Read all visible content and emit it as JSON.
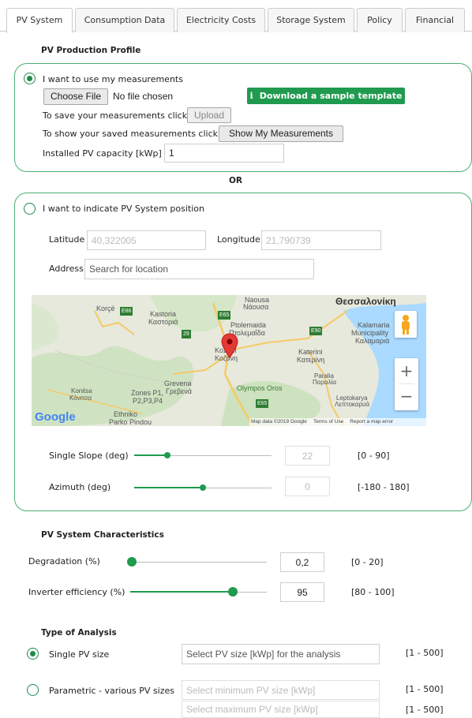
{
  "tabs": [
    {
      "label": "PV System",
      "active": true
    },
    {
      "label": "Consumption Data"
    },
    {
      "label": "Electricity Costs"
    },
    {
      "label": "Storage System"
    },
    {
      "label": "Policy"
    },
    {
      "label": "Financial"
    }
  ],
  "profile": {
    "title": "PV Production Profile",
    "option1": {
      "label": "I want to use my measurements",
      "choose_file": "Choose File",
      "no_file": "No file chosen",
      "download_icon_char": "i",
      "download_label": "Download a sample template",
      "save_text": "To save your measurements click",
      "upload_label": "Upload",
      "show_text": "To show your saved measurements click",
      "show_label": "Show My Measurements",
      "capacity_label": "Installed PV capacity [kWp]",
      "capacity_value": "1"
    },
    "or": "OR",
    "option2": {
      "label": "I want to indicate PV System position",
      "latitude_label": "Latitude",
      "latitude_value": "40,322005",
      "longitude_label": "Longitude",
      "longitude_value": "21,790739",
      "address_label": "Address",
      "address_placeholder": "Search for location",
      "map": {
        "places": [
          "Korçë",
          "Kastoria",
          "Καστοριά",
          "Naousa",
          "Νάουσα",
          "Θεσσαλονίκη",
          "Ptolemaida",
          "Πτολεμαΐδα",
          "Kalamaria",
          "Municipality",
          "Καλαμαριά",
          "Kozani",
          "Κοζάνη",
          "Katerini",
          "Κατερίνη",
          "Paralia",
          "Παραλία",
          "Grevena",
          "Γρεβενά",
          "Olympos Oros",
          "Zones P1,",
          "P2,P3,P4",
          "Konitsa",
          "Κόνιτσα",
          "Leptokarya",
          "Λεπτοκαρυά",
          "Ethniko",
          "Parko Pindou"
        ],
        "roads": [
          "E86",
          "E65",
          "29",
          "E90",
          "E65"
        ],
        "zoom_in": "+",
        "zoom_out": "−",
        "logo": "Google",
        "attribution": "Map data ©2019 Google",
        "terms": "Terms of Use",
        "report": "Report a map error"
      },
      "slope_label": "Single Slope (deg)",
      "slope_value": "22",
      "slope_fraction": 0.24,
      "slope_range": "[0 - 90]",
      "azimuth_label": "Azimuth (deg)",
      "azimuth_value": "0",
      "azimuth_fraction": 0.5,
      "azimuth_range": "[-180 - 180]"
    }
  },
  "characteristics": {
    "title": "PV System Characteristics",
    "degradation_label": "Degradation (%)",
    "degradation_value": "0,2",
    "degradation_fraction": 0.01,
    "degradation_range": "[0 - 20]",
    "inverter_label": "Inverter efficiency (%)",
    "inverter_value": "95",
    "inverter_fraction": 0.75,
    "inverter_range": "[80 - 100]"
  },
  "analysis": {
    "title": "Type of Analysis",
    "single_label": "Single PV size",
    "single_placeholder": "Select PV size [kWp] for the analysis",
    "single_range": "[1 - 500]",
    "param_label": "Parametric - various PV sizes",
    "param_min_placeholder": "Select minimum PV size [kWp]",
    "param_min_range": "[1 - 500]",
    "param_max_placeholder": "Select maximum PV size [kWp]",
    "param_max_range": "[1 - 500]"
  },
  "colors": {
    "accent": "#1f9a4e",
    "border": "#4caf74",
    "pin": "#e53935"
  }
}
